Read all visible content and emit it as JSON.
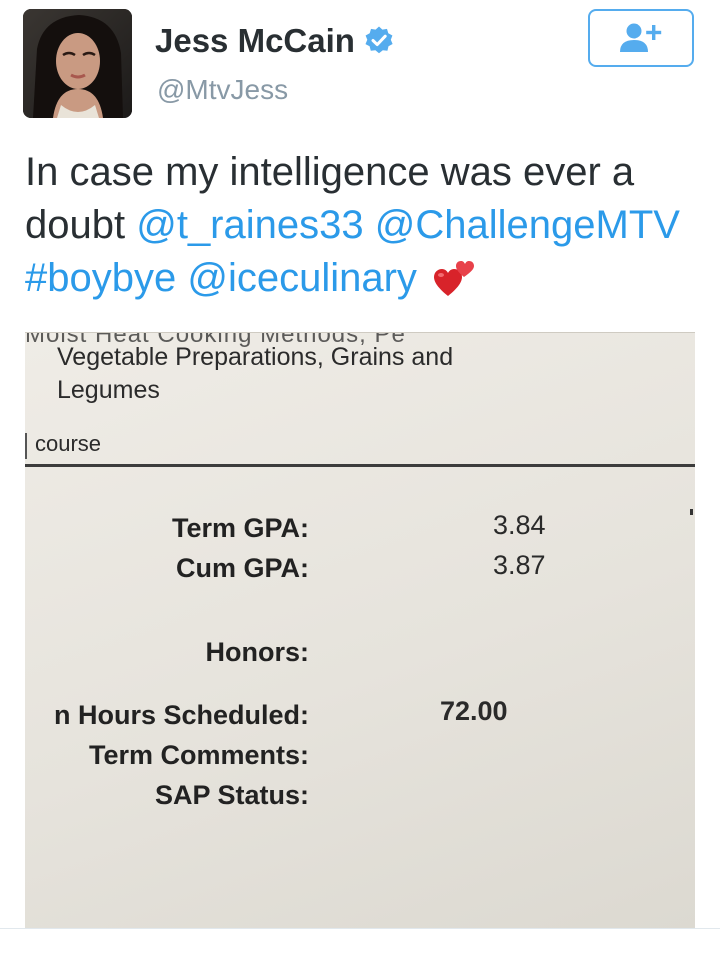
{
  "author": {
    "display_name": "Jess McCain",
    "handle": "@MtvJess",
    "verified": true
  },
  "follow_button": {
    "icon": "add-user-icon"
  },
  "tweet": {
    "text_line1": "In case my intelligence was ever a",
    "text_doubt": "doubt ",
    "mention1": "@t_raines33",
    "mention2": "@ChallengeMTV",
    "hashtag": "#boybye",
    "mention3": "@iceculinary",
    "emoji": "two-hearts-icon"
  },
  "photo": {
    "cut_text": "Moist Heat Cooking Methods, Pe",
    "line1": "Vegetable Preparations, Grains and",
    "line2": "Legumes",
    "course": "course",
    "term_gpa_label": "Term GPA:",
    "term_gpa_value": "3.84",
    "cum_gpa_label": "Cum GPA:",
    "cum_gpa_value": "3.87",
    "honors_label": "Honors:",
    "hours_label": "n Hours Scheduled:",
    "hours_value": "72.00",
    "comments_label": "Term Comments:",
    "sap_label": "SAP Status:"
  },
  "colors": {
    "link": "#2b9ae9",
    "verified": "#55acee",
    "handle": "#8899a6",
    "follow_border": "#55acee"
  }
}
